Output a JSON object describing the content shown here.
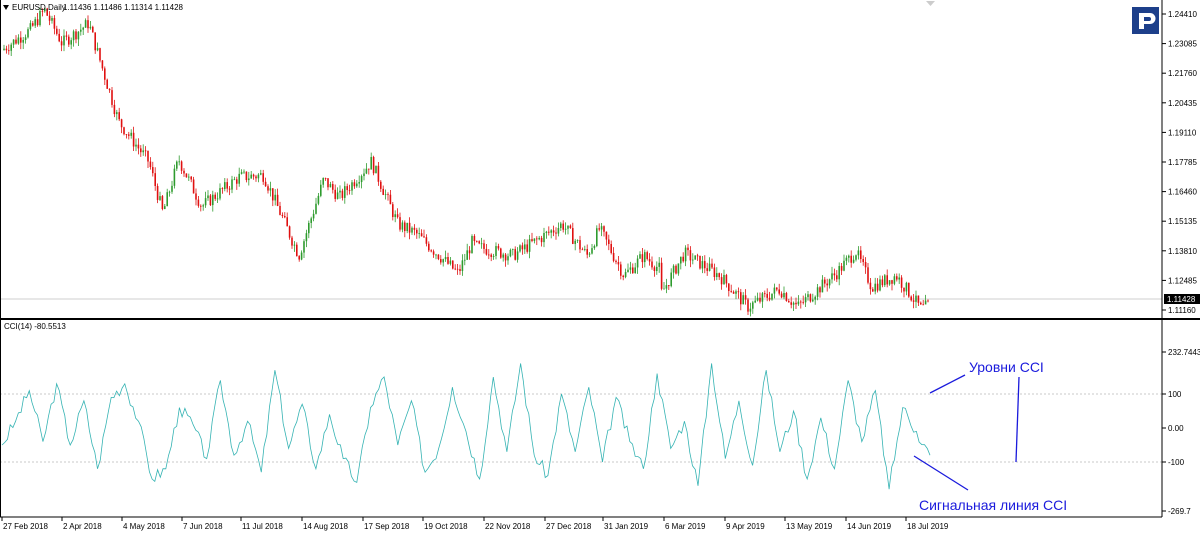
{
  "main_chart": {
    "header_label": "EURUSD,Daily",
    "ohlc": "1.11436 1.11486 1.11314 1.11428",
    "price_axis_ticks": [
      "1.24410",
      "1.23085",
      "1.21760",
      "1.20435",
      "1.19110",
      "1.17785",
      "1.16460",
      "1.15135",
      "1.13810",
      "1.12485",
      "1.11160"
    ],
    "current_price_label": "1.11428",
    "up_color": "#2e9b2e",
    "down_color": "#e01010"
  },
  "indicator": {
    "label": "CCI(14) -80.5513",
    "axis_ticks": [
      "232.7443",
      "100",
      "0.00",
      "-100",
      "-269.7"
    ],
    "line_color": "#35b3b3"
  },
  "time_axis": [
    "27 Feb 2018",
    "2 Apr 2018",
    "4 May 2018",
    "7 Jun 2018",
    "11 Jul 2018",
    "14 Aug 2018",
    "17 Sep 2018",
    "19 Oct 2018",
    "22 Nov 2018",
    "27 Dec 2018",
    "31 Jan 2019",
    "6 Mar 2019",
    "9 Apr 2019",
    "13 May 2019",
    "14 Jun 2019",
    "18 Jul 2019"
  ],
  "annotations": {
    "levels": "Уровни CCI",
    "signal": "Сигнальная линия  CCI",
    "color": "#1a1adc"
  },
  "chart_data": [
    {
      "type": "candlestick",
      "title": "EURUSD,Daily",
      "ylim": [
        1.1085,
        1.2505
      ],
      "anchors": [
        {
          "date": "27 Feb 2018",
          "price": 1.228
        },
        {
          "date": "15 Mar 2018",
          "price": 1.237
        },
        {
          "date": "23 Mar 2018",
          "price": 1.246
        },
        {
          "date": "2 Apr 2018",
          "price": 1.231
        },
        {
          "date": "17 Apr 2018",
          "price": 1.24
        },
        {
          "date": "4 May 2018",
          "price": 1.196
        },
        {
          "date": "21 May 2018",
          "price": 1.178
        },
        {
          "date": "29 May 2018",
          "price": 1.155
        },
        {
          "date": "7 Jun 2018",
          "price": 1.179
        },
        {
          "date": "20 Jun 2018",
          "price": 1.158
        },
        {
          "date": "11 Jul 2018",
          "price": 1.171
        },
        {
          "date": "25 Jul 2018",
          "price": 1.172
        },
        {
          "date": "14 Aug 2018",
          "price": 1.136
        },
        {
          "date": "28 Aug 2018",
          "price": 1.17
        },
        {
          "date": "6 Sep 2018",
          "price": 1.162
        },
        {
          "date": "24 Sep 2018",
          "price": 1.178
        },
        {
          "date": "9 Oct 2018",
          "price": 1.15
        },
        {
          "date": "19 Oct 2018",
          "price": 1.146
        },
        {
          "date": "12 Nov 2018",
          "price": 1.128
        },
        {
          "date": "20 Nov 2018",
          "price": 1.142
        },
        {
          "date": "22 Nov 2018",
          "price": 1.14
        },
        {
          "date": "13 Dec 2018",
          "price": 1.136
        },
        {
          "date": "10 Jan 2019",
          "price": 1.15
        },
        {
          "date": "24 Jan 2019",
          "price": 1.136
        },
        {
          "date": "31 Jan 2019",
          "price": 1.148
        },
        {
          "date": "14 Feb 2019",
          "price": 1.127
        },
        {
          "date": "25 Feb 2019",
          "price": 1.136
        },
        {
          "date": "6 Mar 2019",
          "price": 1.13
        },
        {
          "date": "7 Mar 2019",
          "price": 1.119
        },
        {
          "date": "20 Mar 2019",
          "price": 1.137
        },
        {
          "date": "9 Apr 2019",
          "price": 1.127
        },
        {
          "date": "25 Apr 2019",
          "price": 1.113
        },
        {
          "date": "13 May 2019",
          "price": 1.121
        },
        {
          "date": "23 May 2019",
          "price": 1.113
        },
        {
          "date": "14 Jun 2019",
          "price": 1.128
        },
        {
          "date": "25 Jun 2019",
          "price": 1.138
        },
        {
          "date": "4 Jul 2019",
          "price": 1.122
        },
        {
          "date": "18 Jul 2019",
          "price": 1.127
        },
        {
          "date": "1 Aug 2019",
          "price": 1.112
        },
        {
          "date": "6 Aug 2019",
          "price": 1.114
        }
      ]
    },
    {
      "type": "line",
      "title": "CCI(14) -80.5513",
      "ylim": [
        -269.7,
        232.7443
      ],
      "levels": [
        100,
        -100
      ],
      "series": [
        {
          "values": [
            -50,
            20,
            110,
            -40,
            130,
            -50,
            80,
            -120,
            90,
            130,
            20,
            -150,
            -120,
            60,
            10,
            -90,
            140,
            -80,
            20,
            -130,
            170,
            -60,
            70,
            -120,
            40,
            -90,
            -160,
            60,
            150,
            -50,
            80,
            -130,
            -60,
            120,
            -10,
            -150,
            150,
            -70,
            190,
            -80,
            -140,
            100,
            -70,
            120,
            -100,
            90,
            -40,
            -120,
            160,
            -60,
            20,
            -170,
            190,
            -90,
            80,
            -110,
            170,
            -70,
            50,
            -150,
            30,
            -120,
            140,
            -40,
            110,
            -180,
            60,
            -10,
            -80
          ]
        }
      ]
    }
  ]
}
